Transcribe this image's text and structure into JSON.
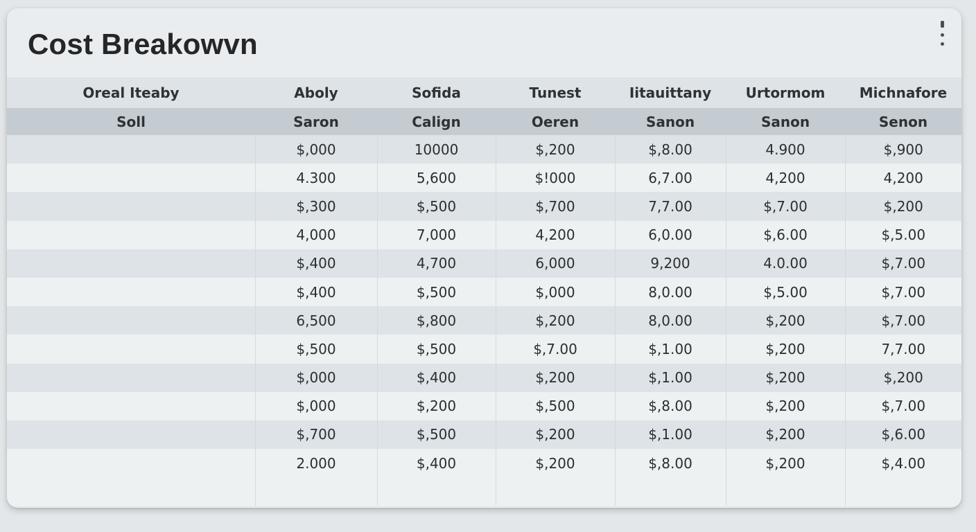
{
  "title": "Cost Breakowvn",
  "menu": {
    "icon": "more-vertical-icon"
  },
  "table": {
    "header_row_1": [
      "Oreal Iteaby",
      "Aboly",
      "Sofida",
      "Tunest",
      "Iitauittany",
      "Urtormom",
      "Michnafore"
    ],
    "header_row_2": [
      "Soll",
      "Saron",
      "Calign",
      "Oeren",
      "Sanon",
      "Sanon",
      "Senon"
    ],
    "rows": [
      [
        "",
        "$,000",
        "10000",
        "$,200",
        "$,8.00",
        "4.900",
        "$,900"
      ],
      [
        "",
        "4.300",
        "5,600",
        "$!000",
        "6,7.00",
        "4,200",
        "4,200"
      ],
      [
        "",
        "$,300",
        "$,500",
        "$,700",
        "7,7.00",
        "$,7.00",
        "$,200"
      ],
      [
        "",
        "4,000",
        "7,000",
        "4,200",
        "6,0.00",
        "$,6.00",
        "$,5.00"
      ],
      [
        "",
        "$,400",
        "4,700",
        "6,000",
        "9,200",
        "4.0.00",
        "$,7.00"
      ],
      [
        "",
        "$,400",
        "$,500",
        "$,000",
        "8,0.00",
        "$,5.00",
        "$,7.00"
      ],
      [
        "",
        "6,500",
        "$,800",
        "$,200",
        "8,0.00",
        "$,200",
        "$,7.00"
      ],
      [
        "",
        "$,500",
        "$,500",
        "$,7.00",
        "$,1.00",
        "$,200",
        "7,7.00"
      ],
      [
        "",
        "$,000",
        "$,400",
        "$,200",
        "$,1.00",
        "$,200",
        "$,200"
      ],
      [
        "",
        "$,000",
        "$,200",
        "$,500",
        "$,8.00",
        "$,200",
        "$,7.00"
      ],
      [
        "",
        "$,700",
        "$,500",
        "$,200",
        "$,1.00",
        "$,200",
        "$,6.00"
      ],
      [
        "",
        "2.000",
        "$,400",
        "$,200",
        "$,8.00",
        "$,200",
        "$,4.00"
      ],
      [
        "",
        "",
        "",
        "",
        "",
        "",
        ""
      ]
    ]
  },
  "colors": {
    "background": "#e3e7e9",
    "card": "#e9edef",
    "header_primary": "#dde3e6",
    "header_secondary": "#c4ccd1",
    "row_stripe_dark": "#dde3e6",
    "row_stripe_light": "#eef1f2",
    "text": "#262626"
  }
}
